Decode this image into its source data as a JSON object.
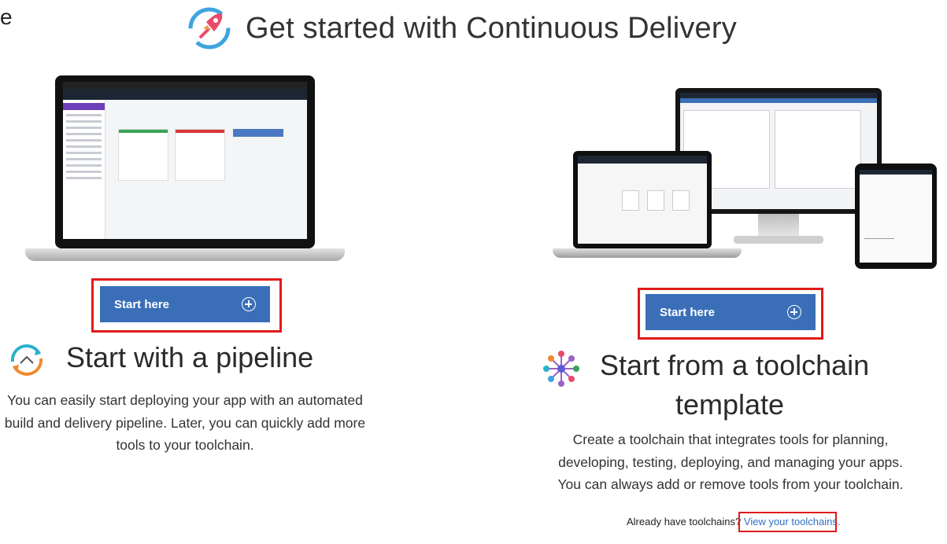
{
  "page": {
    "edge_char": "e",
    "title": "Get started with Continuous Delivery",
    "icons": {
      "header": "rocket-cycle-icon",
      "pipeline": "pipeline-cycle-icon",
      "toolchain": "toolchain-network-icon",
      "plus": "plus-circle-icon"
    },
    "colors": {
      "button": "#3a6fb8",
      "highlight": "#e01b1b",
      "link": "#2f6fc4"
    }
  },
  "pipeline": {
    "button_label": "Start here",
    "title": "Start with a pipeline",
    "description_lines": [
      "You can easily start deploying your app with an automated",
      "build and delivery pipeline. Later, you can quickly add more",
      "tools to your toolchain."
    ]
  },
  "toolchain": {
    "button_label": "Start here",
    "title_lines": [
      "Start from a toolchain",
      "template"
    ],
    "description_lines": [
      "Create a toolchain that integrates tools for planning,",
      "developing, testing, deploying, and managing your apps.",
      "You can always add or remove tools from your toolchain."
    ],
    "already_text": "Already have toolchains?",
    "view_link": "View your toolchains."
  }
}
